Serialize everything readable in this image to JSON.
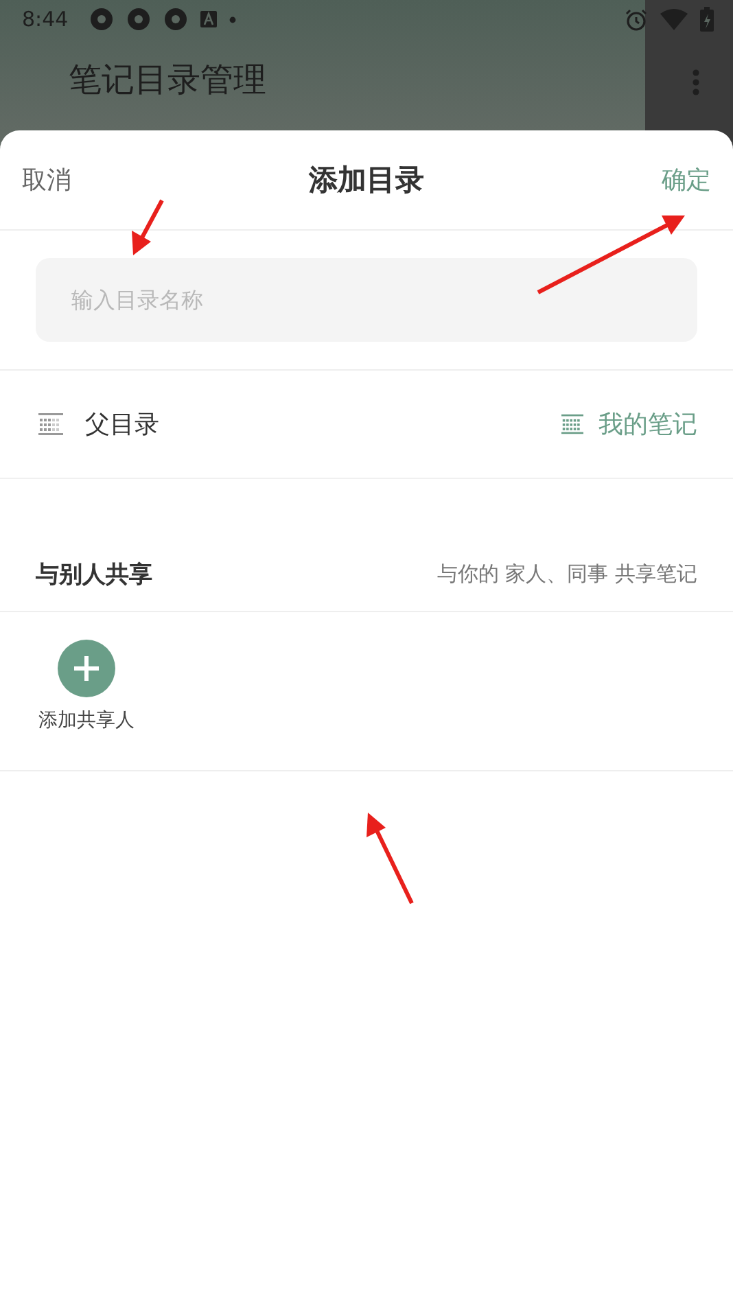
{
  "status_bar": {
    "time": "8:44"
  },
  "background_screen": {
    "title": "笔记目录管理"
  },
  "sheet": {
    "cancel": "取消",
    "title": "添加目录",
    "confirm": "确定",
    "name_field": {
      "placeholder": "输入目录名称"
    },
    "parent_row": {
      "label": "父目录",
      "value": "我的笔记"
    },
    "share_section": {
      "title": "与别人共享",
      "hint": "与你的 家人、同事 共享笔记"
    },
    "add_sharer": {
      "label": "添加共享人"
    }
  }
}
